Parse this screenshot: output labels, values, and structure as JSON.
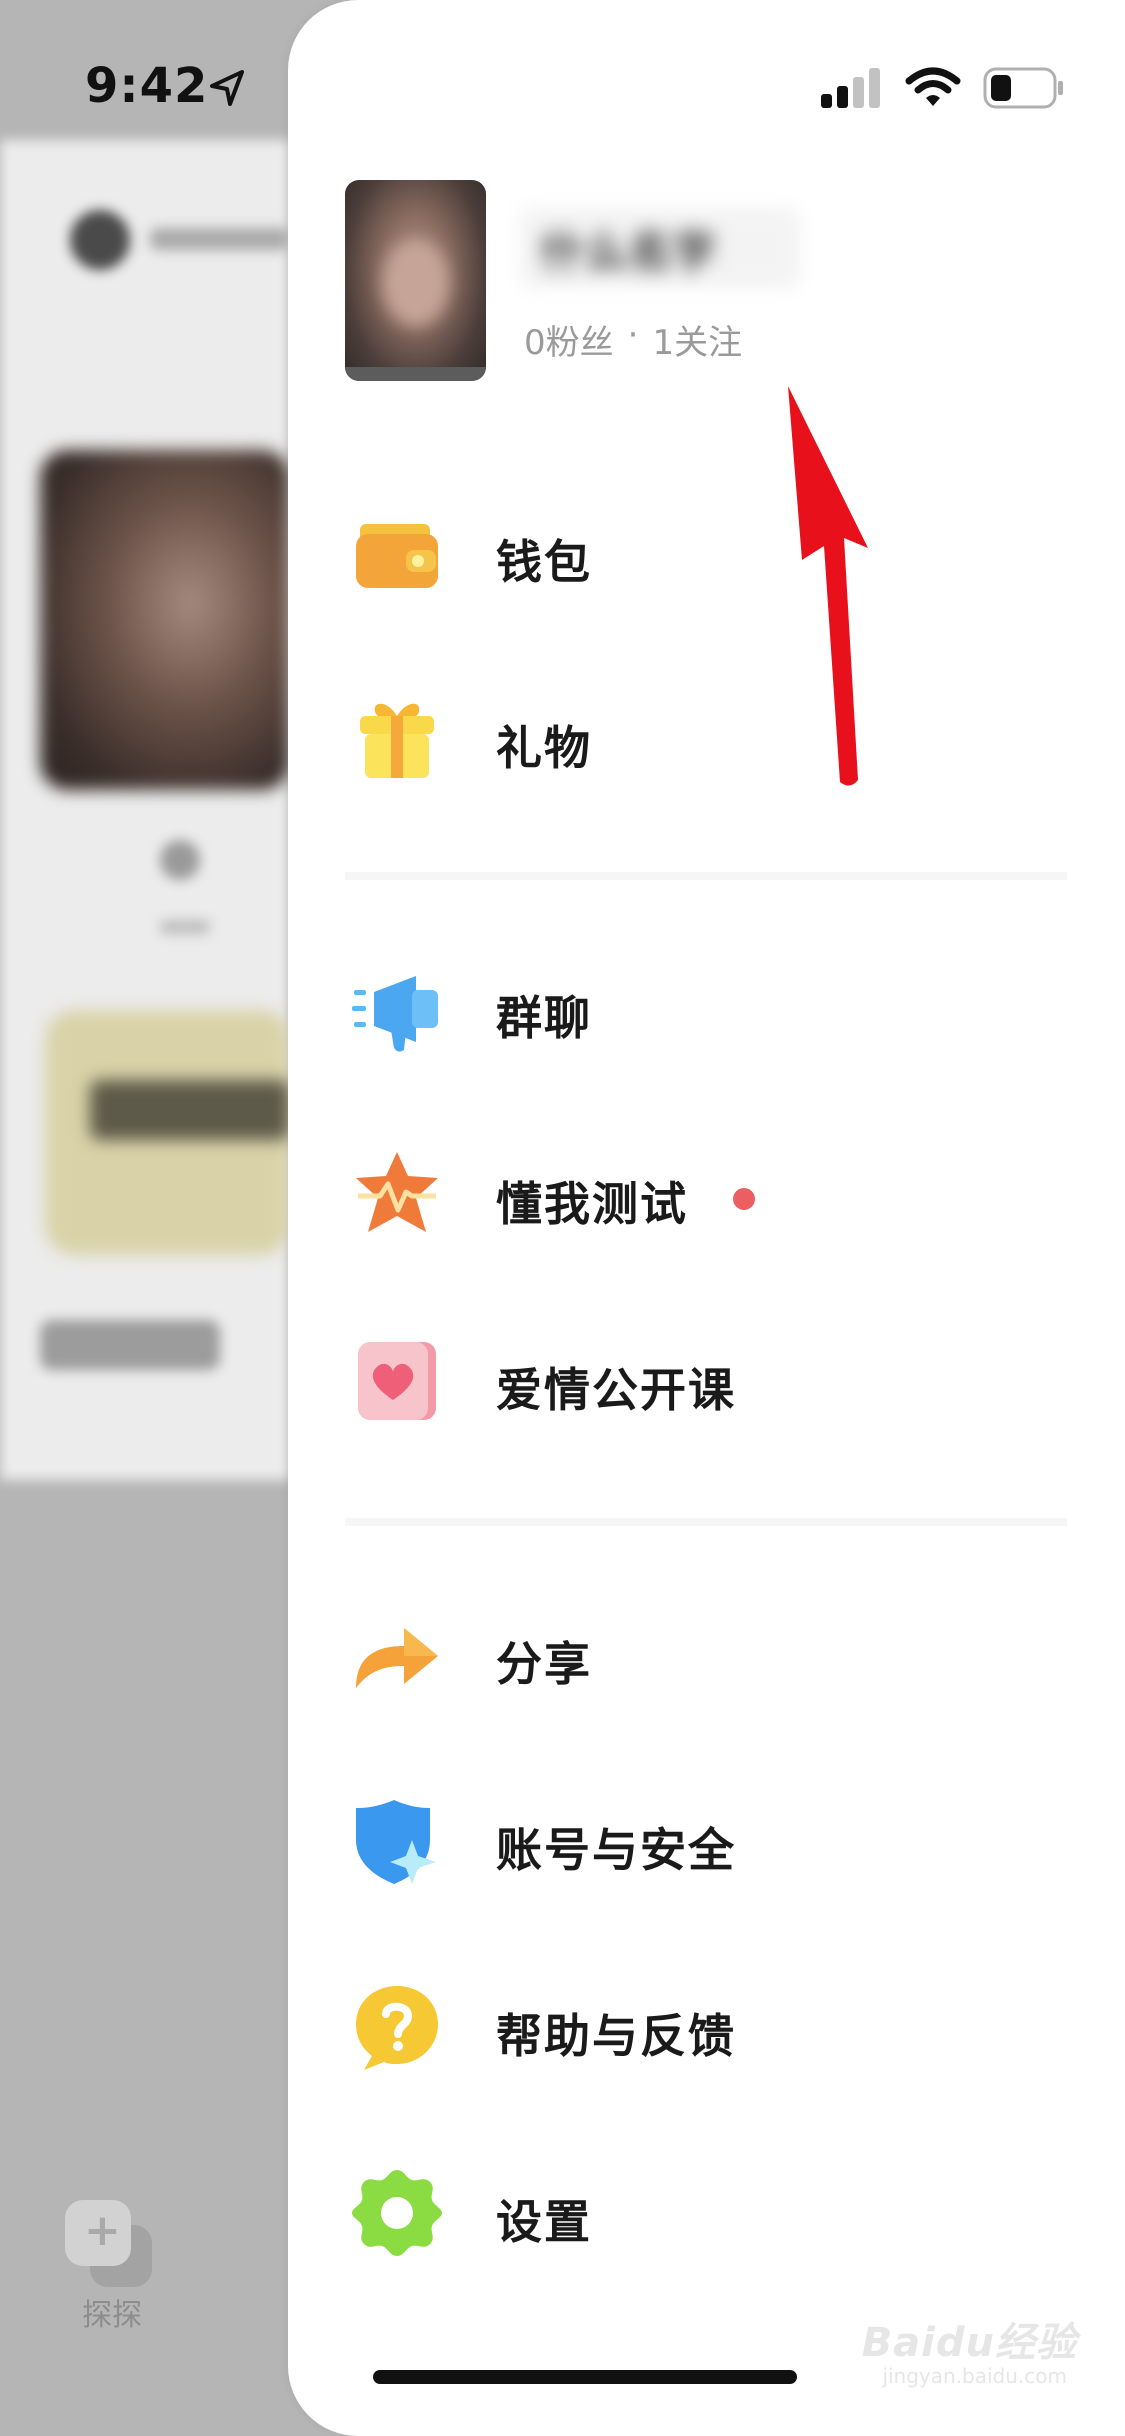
{
  "status_bar": {
    "time": "9:42"
  },
  "background": {
    "tab_label": "探探"
  },
  "profile": {
    "name": "什么名字",
    "fans": "0粉丝",
    "separator": "·",
    "following": "1关注"
  },
  "menu": {
    "wallet": "钱包",
    "gift": "礼物",
    "group_chat": "群聊",
    "test": "懂我测试",
    "love_course": "爱情公开课",
    "share": "分享",
    "account_security": "账号与安全",
    "help_feedback": "帮助与反馈",
    "settings": "设置"
  },
  "watermark": {
    "brand": "Baidu经验",
    "url": "jingyan.baidu.com"
  },
  "colors": {
    "drawer_bg": "#ffffff",
    "overlay_bg": "#b5b5b5",
    "red_dot": "#ec5f60",
    "arrow": "#e8101b",
    "label_text": "#1a1a1a",
    "stats_text": "#9a9a9a"
  }
}
